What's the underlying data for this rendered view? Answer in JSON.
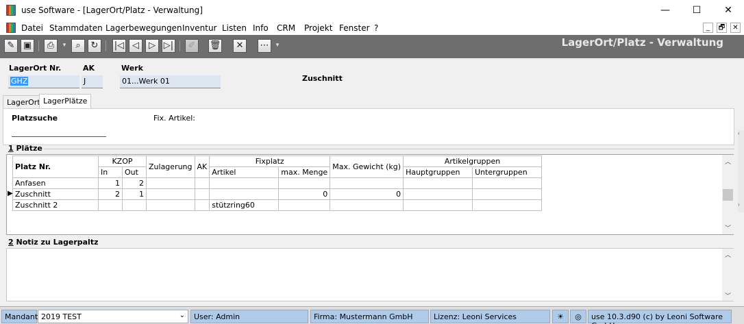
{
  "window": {
    "title": "use Software - [LagerOrt/Platz - Verwaltung]",
    "minimize": "—",
    "maximize": "☐",
    "close": "✕"
  },
  "menu": {
    "items": [
      "Datei",
      "Stammdaten",
      "Lagerbewegungen",
      "Inventur",
      "Listen",
      "Info",
      "CRM",
      "Projekt",
      "Fenster",
      "?"
    ],
    "mdi_buttons": [
      "_",
      "🗗",
      "✕"
    ]
  },
  "toolbar": {
    "form_title": "LagerOrt/Platz - Verwaltung",
    "icons": [
      "edit-icon",
      "save-icon",
      "print-icon",
      "search-icon",
      "refresh-icon",
      "first-record-icon",
      "prev-record-icon",
      "next-record-icon",
      "last-record-icon",
      "pen-icon",
      "delete-icon",
      "cancel-icon",
      "more-icon"
    ]
  },
  "header": {
    "lagerort_label": "LagerOrt Nr.",
    "lagerort_value": "GHZ",
    "ak_label": "AK",
    "ak_value": "J",
    "werk_label": "Werk",
    "werk_value": "01...Werk 01",
    "info_text": "Zuschnitt"
  },
  "tabs": [
    {
      "label": "LagerOrt"
    },
    {
      "label": "LagerPlätze"
    }
  ],
  "tab_panel": {
    "platzsuche_label": "Platzsuche",
    "fix_artikel_label": "Fix. Artikel:"
  },
  "section1": {
    "num": "1",
    "title": " Plätze"
  },
  "grid": {
    "headers": {
      "platz": "Platz Nr.",
      "kzop": "KZOP",
      "in": "In",
      "out": "Out",
      "zulagerung": "Zulagerung",
      "ak": "AK",
      "fixplatz": "Fixplatz",
      "artikel": "Artikel",
      "max_menge": "max. Menge",
      "max_gewicht": "Max. Gewicht (kg)",
      "artikelgruppen": "Artikelgruppen",
      "hauptgruppen": "Hauptgruppen",
      "untergruppen": "Untergruppen"
    },
    "rows": [
      {
        "marker": "",
        "platz": "Anfasen",
        "in": "1",
        "out": "2",
        "zulagerung": "",
        "ak": "",
        "artikel": "",
        "max_menge": "",
        "max_gewicht": "",
        "haupt": "",
        "unter": ""
      },
      {
        "marker": "▶",
        "platz": "Zuschnitt",
        "in": "2",
        "out": "1",
        "zulagerung": "",
        "ak": "",
        "artikel": "",
        "max_menge": "0",
        "max_gewicht": "0",
        "haupt": "",
        "unter": ""
      },
      {
        "marker": "",
        "platz": "Zuschnitt 2",
        "in": "",
        "out": "",
        "zulagerung": "",
        "ak": "",
        "artikel": "stützring60",
        "max_menge": "",
        "max_gewicht": "",
        "haupt": "",
        "unter": ""
      }
    ]
  },
  "section2": {
    "num": "2",
    "title": " Notiz zu Lagerpaltz"
  },
  "status": {
    "mandant_label": "Mandant",
    "mandant_value": "2019 TEST",
    "user": "User: Admin",
    "firma": "Firma: Mustermann GmbH",
    "lizenz": "Lizenz: Leoni Services",
    "version": "use 10.3.d90 (c) by Leoni Software GmbH"
  }
}
